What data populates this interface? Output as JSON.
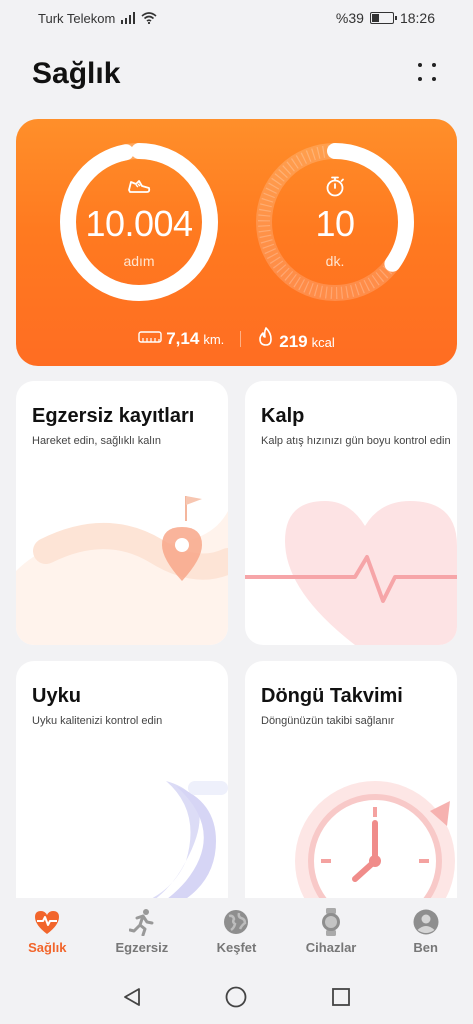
{
  "status_bar": {
    "carrier": "Turk Telekom",
    "battery_text": "%39",
    "battery_level": 0.39,
    "time": "18:26",
    "icons": [
      "signal-icon",
      "wifi-icon",
      "battery-icon"
    ]
  },
  "header": {
    "title": "Sağlık",
    "menu_icon": "more-dots-icon"
  },
  "activity": {
    "steps": {
      "value": "10.004",
      "unit": "adım",
      "progress": 0.97,
      "icon": "shoe-icon"
    },
    "minutes": {
      "value": "10",
      "unit": "dk.",
      "progress": 0.35,
      "icon": "stopwatch-icon"
    },
    "distance": {
      "value": "7,14",
      "unit": "km.",
      "icon": "ruler-icon"
    },
    "calories": {
      "value": "219",
      "unit": "kcal",
      "icon": "flame-icon"
    },
    "colors": {
      "card": "#ff7a20",
      "ring": "#ffffff"
    }
  },
  "tiles": [
    {
      "title": "Egzersiz kayıtları",
      "subtitle": "Hareket edin, sağlıklı kalın",
      "icon": "map-pin-icon"
    },
    {
      "title": "Kalp",
      "subtitle": "Kalp atış hızınızı gün boyu kontrol edin",
      "icon": "heart-icon"
    },
    {
      "title": "Uyku",
      "subtitle": "Uyku kalitenizi kontrol edin",
      "icon": "moon-icon"
    },
    {
      "title": "Döngü Takvimi",
      "subtitle": "Döngünüzün takibi sağlanır",
      "icon": "clock-icon"
    }
  ],
  "bottom_nav": [
    {
      "label": "Sağlık",
      "icon": "heart-pulse-icon",
      "active": true
    },
    {
      "label": "Egzersiz",
      "icon": "running-icon",
      "active": false
    },
    {
      "label": "Keşfet",
      "icon": "globe-icon",
      "active": false
    },
    {
      "label": "Cihazlar",
      "icon": "watch-icon",
      "active": false
    },
    {
      "label": "Ben",
      "icon": "person-icon",
      "active": false
    }
  ],
  "colors": {
    "accent": "#f2652b",
    "background": "#f2f2f4"
  }
}
